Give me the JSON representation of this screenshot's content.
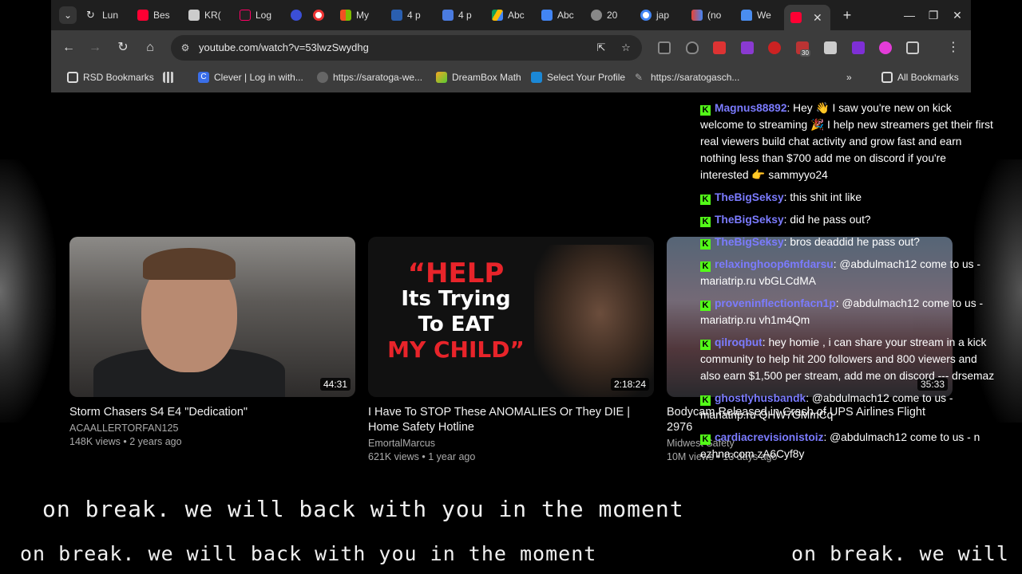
{
  "browser": {
    "tabs": [
      {
        "label": "Lun",
        "icon": "refresh-icon"
      },
      {
        "label": "Bes",
        "icon": "youtube-icon"
      },
      {
        "label": "KR(",
        "icon": "qr-icon"
      },
      {
        "label": "Log",
        "icon": "a-icon"
      },
      {
        "label": "",
        "icon": "r-icon"
      },
      {
        "label": "",
        "icon": "record-icon"
      },
      {
        "label": "My",
        "icon": "microsoft-icon"
      },
      {
        "label": "4 p",
        "icon": "r-logo-icon"
      },
      {
        "label": "4 p",
        "icon": "check-doc-icon"
      },
      {
        "label": "Abc",
        "icon": "drive-icon"
      },
      {
        "label": "Abc",
        "icon": "docs-icon"
      },
      {
        "label": "20",
        "icon": "globe-icon"
      },
      {
        "label": "jap",
        "icon": "google-icon"
      },
      {
        "label": "(no",
        "icon": "gmail-icon"
      },
      {
        "label": "We",
        "icon": "lock-icon"
      }
    ],
    "url": "youtube.com/watch?v=53lwzSwydhg",
    "extension_badge": "30",
    "bookmarks": [
      {
        "label": "RSD Bookmarks",
        "icon": "folder-icon"
      },
      {
        "label": "",
        "icon": "apps-grid-icon"
      },
      {
        "label": "Clever | Log in with...",
        "icon": "clever-icon"
      },
      {
        "label": "https://saratoga-we...",
        "icon": "globe-icon"
      },
      {
        "label": "DreamBox Math",
        "icon": "dreambox-icon"
      },
      {
        "label": "Select Your Profile",
        "icon": "edge-icon"
      },
      {
        "label": "https://saratogasch...",
        "icon": "pen-icon"
      }
    ],
    "all_bookmarks": "All Bookmarks",
    "more_bookmarks": "»"
  },
  "videos": [
    {
      "title": "Storm Chasers S4 E4 \"Dedication\"",
      "channel": "ACAALLERTORFAN125",
      "meta": "148K views • 2 years ago",
      "duration": "44:31"
    },
    {
      "title": "I Have To STOP These ANOMALIES Or They DIE | Home Safety Hotline",
      "channel": "EmortalMarcus",
      "meta": "621K views • 1 year ago",
      "duration": "2:18:24",
      "thumb_text": [
        "“HELP",
        "Its Trying",
        "To EAT",
        "MY CHILD”"
      ]
    },
    {
      "title": "Bodycam Released in Crash of UPS Airlines Flight 2976",
      "channel": "Midwest Safety",
      "meta": "10M views • 13 days ago",
      "duration": "35:33"
    }
  ],
  "chat": {
    "cut_line": "...",
    "messages": [
      {
        "user": "Magnus88892",
        "text": "Hey 👋 I saw you're new on kick welcome to streaming 🎉 I help new streamers get their first real viewers build chat activity and grow fast and earn nothing less than $700 add me on discord if you're interested 👉 sammyyo24"
      },
      {
        "user": "TheBigSeksy",
        "text": "this shit int like"
      },
      {
        "user": "TheBigSeksy",
        "text": "did he pass out?"
      },
      {
        "user": "TheBigSeksy",
        "text": "bros deaddid he pass out?"
      },
      {
        "user": "relaxinghoop6mfdarsu",
        "text": "@abdulmach12 come to us - mariatrip.ru vbGLCdMA"
      },
      {
        "user": "proveninflectionfacn1p",
        "text": "@abdulmach12 come to us - mariatrip.ru vh1m4Qm"
      },
      {
        "user": "qilroqbut",
        "text": "hey homie , i can share your stream in a kick community to help hit 200 followers and 800 viewers and also earn $1,500 per stream, add me on discord --- drsemaz"
      },
      {
        "user": "ghostlyhusbandk",
        "text": "@abdulmach12 come to us - mariatrip.ru QHW7GMmCq"
      },
      {
        "user": "cardiacrevisionistoiz",
        "text": "@abdulmach12 come to us - n ezhna.com zA6Cyf8y"
      }
    ]
  },
  "overlay": {
    "break_text": "on break. we will back with you in the moment",
    "ticker_a": "on break. we will back with you in the moment",
    "ticker_b": "on break. we will"
  }
}
